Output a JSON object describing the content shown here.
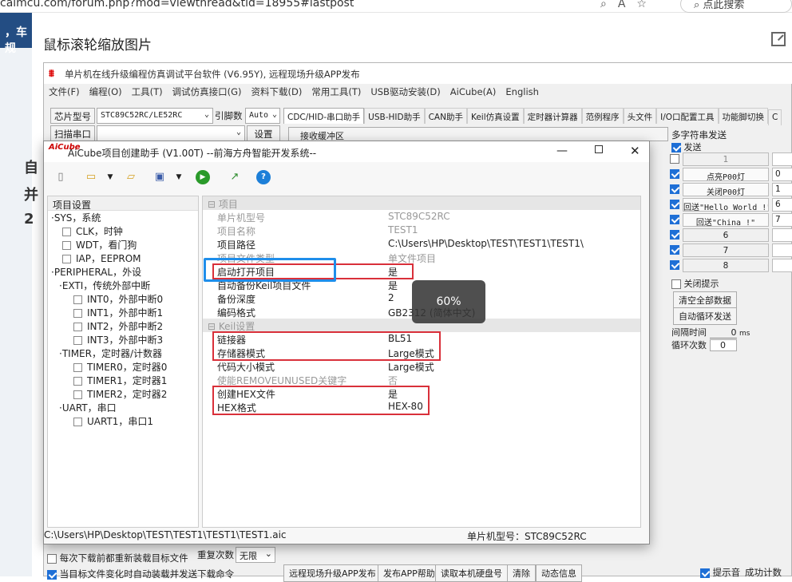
{
  "browser": {
    "url": "caimcu.com/forum.php?mod=viewthread&tid=18955#lastpost",
    "search_placeholder": "点此搜索",
    "icons": [
      "zoom-icon",
      "read-aloud-icon",
      "favorite-star-icon"
    ]
  },
  "forum": {
    "sidebar_top": "，车规",
    "sidebar_chars": [
      "自",
      "并",
      "2"
    ],
    "page_title": "鼠标滚轮缩放图片"
  },
  "app": {
    "title": "单片机在线升级编程仿真调试平台软件 (V6.95Y), 远程现场升级APP发布",
    "menu": [
      "文件(F)",
      "编程(O)",
      "工具(T)",
      "调试仿真接口(G)",
      "资料下载(D)",
      "常用工具(T)",
      "USB驱动安装(D)",
      "AiCube(A)",
      "English"
    ],
    "chip_label": "芯片型号",
    "chip_value": "STC89C52RC/LE52RC",
    "pins_label": "引脚数",
    "pins_value": "Auto",
    "scan_label": "扫描串口",
    "settings_label": "设置",
    "tabs": [
      "CDC/HID-串口助手",
      "USB-HID助手",
      "CAN助手",
      "Keil仿真设置",
      "定时器计算器",
      "范例程序",
      "头文件",
      "I/O口配置工具",
      "功能脚切换",
      "C"
    ],
    "recv_buffer": "接收缓冲区",
    "multi_send": {
      "title": "多字符串发送",
      "send_label": "发送",
      "rows": [
        {
          "checked": false,
          "label": "1",
          "value": ""
        },
        {
          "checked": true,
          "label": "点亮P00灯",
          "value": "0"
        },
        {
          "checked": true,
          "label": "关闭P00灯",
          "value": "1"
        },
        {
          "checked": true,
          "label": "回送\"Hello World !\"",
          "value": "6"
        },
        {
          "checked": true,
          "label": "回送\"China !\"",
          "value": "7"
        },
        {
          "checked": true,
          "label": "6",
          "value": ""
        },
        {
          "checked": true,
          "label": "7",
          "value": ""
        },
        {
          "checked": true,
          "label": "8",
          "value": ""
        }
      ],
      "close_hint": "关闭提示",
      "clear_all": "清空全部数据",
      "auto_loop": "自动循环发送",
      "interval_label": "间隔时间",
      "interval_value": "0",
      "interval_unit": "ms",
      "loop_label": "循环次数",
      "loop_value": "0"
    },
    "bottom": {
      "reload_label": "每次下载前都重新装载目标文件",
      "auto_load_label": "当目标文件变化时自动装载并发送下载命令",
      "retry_label": "重复次数",
      "retry_value": "无限",
      "buttons": [
        "远程现场升级APP发布",
        "发布APP帮助",
        "读取本机硬盘号",
        "清除",
        "动态信息"
      ],
      "beep_label": "提示音",
      "success_label": "成功计数"
    }
  },
  "dialog": {
    "logo": "AiCube",
    "title": "AiCube项目创建助手 (V1.00T) --前海方舟智能开发系统--",
    "tree_header": "项目设置",
    "tree": [
      {
        "level": 0,
        "label": "SYS，系统",
        "checkbox": false
      },
      {
        "level": 1,
        "label": "CLK，时钟",
        "checkbox": true
      },
      {
        "level": 1,
        "label": "WDT，看门狗",
        "checkbox": true
      },
      {
        "level": 1,
        "label": "IAP，EEPROM",
        "checkbox": true
      },
      {
        "level": 0,
        "label": "PERIPHERAL，外设",
        "checkbox": false
      },
      {
        "level": 1,
        "label": "EXTI，传统外部中断",
        "checkbox": false
      },
      {
        "level": 2,
        "label": "INT0，外部中断0",
        "checkbox": true
      },
      {
        "level": 2,
        "label": "INT1，外部中断1",
        "checkbox": true
      },
      {
        "level": 2,
        "label": "INT2，外部中断2",
        "checkbox": true
      },
      {
        "level": 2,
        "label": "INT3，外部中断3",
        "checkbox": true
      },
      {
        "level": 1,
        "label": "TIMER，定时器/计数器",
        "checkbox": false
      },
      {
        "level": 2,
        "label": "TIMER0，定时器0",
        "checkbox": true
      },
      {
        "level": 2,
        "label": "TIMER1，定时器1",
        "checkbox": true
      },
      {
        "level": 2,
        "label": "TIMER2，定时器2",
        "checkbox": true
      },
      {
        "level": 1,
        "label": "UART，串口",
        "checkbox": false
      },
      {
        "level": 2,
        "label": "UART1，串口1",
        "checkbox": true
      }
    ],
    "grid": {
      "cat_project": "项目",
      "rows_project": [
        {
          "key": "单片机型号",
          "value": "STC89C52RC",
          "dim": true
        },
        {
          "key": "项目名称",
          "value": "TEST1",
          "dim": true
        },
        {
          "key": "项目路径",
          "value": "C:\\Users\\HP\\Desktop\\TEST\\TEST1\\TEST1\\",
          "dim": false
        },
        {
          "key": "项目文件类型",
          "value": "单文件项目",
          "dim": true
        },
        {
          "key": "启动打开项目",
          "value": "是",
          "dim": false
        },
        {
          "key": "自动备份Keil项目文件",
          "value": "是",
          "dim": false
        },
        {
          "key": "备份深度",
          "value": "2",
          "dim": false
        },
        {
          "key": "编码格式",
          "value": "GB2312 (简体中文)",
          "dim": false
        }
      ],
      "cat_keil": "Keil设置",
      "rows_keil": [
        {
          "key": "链接器",
          "value": "BL51",
          "dim": false
        },
        {
          "key": "存储器模式",
          "value": "Large模式",
          "dim": false
        },
        {
          "key": "代码大小模式",
          "value": "Large模式",
          "dim": false
        },
        {
          "key": "使能REMOVEUNUSED关键字",
          "value": "否",
          "dim": true
        },
        {
          "key": "创建HEX文件",
          "value": "是",
          "dim": false
        },
        {
          "key": "HEX格式",
          "value": "HEX-80",
          "dim": false
        }
      ]
    },
    "zoom": "60%",
    "status_path": "C:\\Users\\HP\\Desktop\\TEST\\TEST1\\TEST1\\TEST1.aic",
    "status_chip": "单片机型号：STC89C52RC"
  },
  "colors": {
    "accent": "#1e6fd6",
    "highlight_red": "#d9303a",
    "highlight_blue": "#1f8eea",
    "forum_blue": "#234d83"
  }
}
